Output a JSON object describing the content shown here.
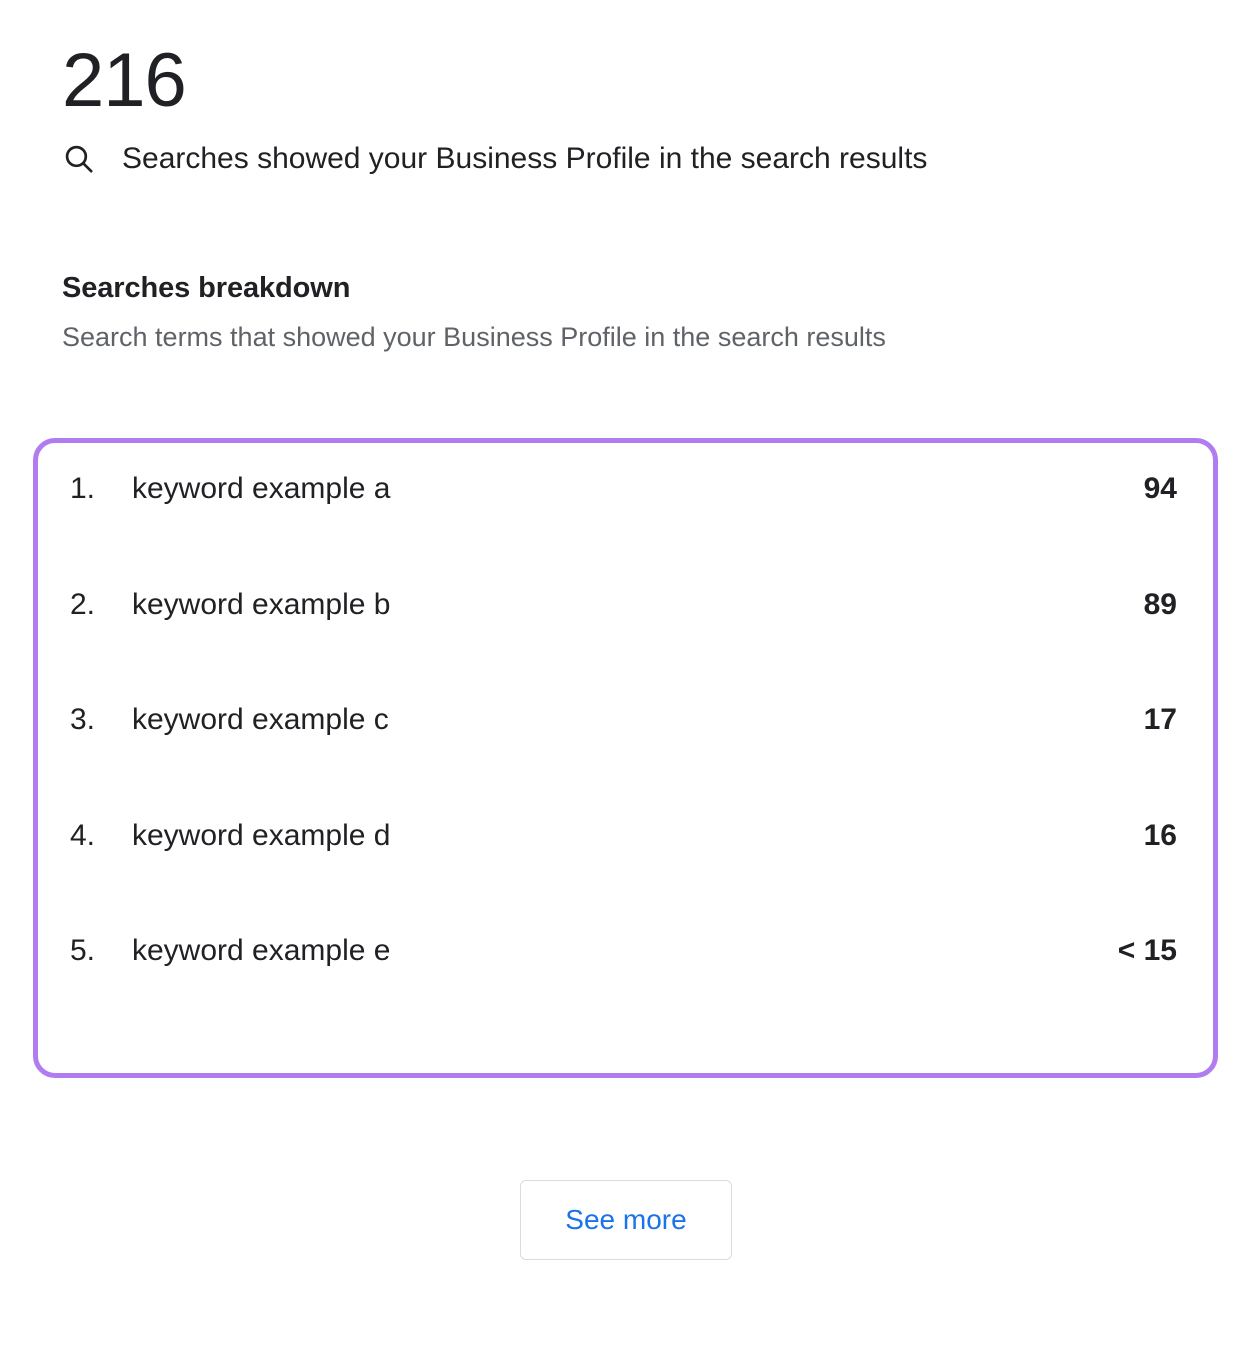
{
  "metric": {
    "value": "216",
    "caption": "Searches showed your Business Profile in the search results",
    "icon": "search-icon"
  },
  "breakdown": {
    "title": "Searches breakdown",
    "subtitle": "Search terms that showed your Business Profile in the search results",
    "rows": [
      {
        "rank": "1.",
        "term": "keyword example a",
        "value": "94"
      },
      {
        "rank": "2.",
        "term": "keyword example b",
        "value": "89"
      },
      {
        "rank": "3.",
        "term": "keyword example c",
        "value": "17"
      },
      {
        "rank": "4.",
        "term": "keyword example d",
        "value": "16"
      },
      {
        "rank": "5.",
        "term": "keyword example e",
        "value": "< 15"
      }
    ]
  },
  "actions": {
    "see_more_label": "See more"
  },
  "colors": {
    "highlight_border": "#b07cf0",
    "link_blue": "#1a73e8",
    "text_primary": "#202124",
    "text_secondary": "#5f6368",
    "button_border": "#dadce0"
  }
}
